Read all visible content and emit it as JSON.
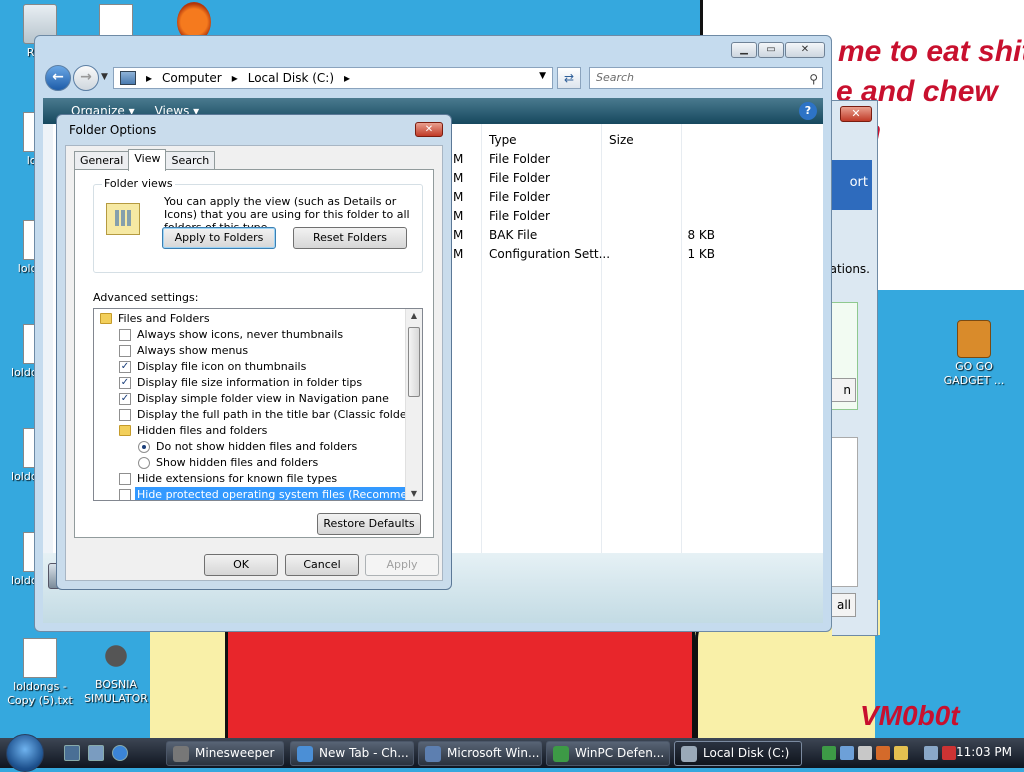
{
  "desktop": {
    "meme_lines": [
      "me to eat shit",
      "e and chew",
      "um"
    ],
    "watermark": "VM0b0t",
    "icons": [
      {
        "label": "Recy",
        "glyph": "recycle-bin"
      },
      {
        "label": "",
        "glyph": "document"
      },
      {
        "label": "",
        "glyph": "firefox"
      },
      {
        "label": "loldo",
        "glyph": "document"
      },
      {
        "label": "loldo Co",
        "glyph": "document"
      },
      {
        "label": "loldo Copy",
        "glyph": "document"
      },
      {
        "label": "loldo Copy",
        "glyph": "document"
      },
      {
        "label": "loldo Copy",
        "glyph": "document"
      },
      {
        "label": "loldongs - Copy (5).txt",
        "glyph": "document"
      },
      {
        "label": "BOSNIA SIMULATOR",
        "glyph": "minesweeper"
      },
      {
        "label": "GO GO GADGET ...",
        "glyph": "briefcase"
      }
    ]
  },
  "explorer": {
    "address_parts": [
      "Computer",
      "Local Disk (C:)"
    ],
    "search_placeholder": "Search",
    "cmd_organize": "Organize ▾",
    "cmd_views": "Views ▾",
    "columns": {
      "type": "Type",
      "size": "Size"
    },
    "rows": [
      {
        "mod": "M",
        "type": "File Folder",
        "size": ""
      },
      {
        "mod": "M",
        "type": "File Folder",
        "size": ""
      },
      {
        "mod": "M",
        "type": "File Folder",
        "size": ""
      },
      {
        "mod": "M",
        "type": "File Folder",
        "size": ""
      },
      {
        "mod": "M",
        "type": "BAK File",
        "size": "8 KB"
      },
      {
        "mod": "M",
        "type": "Configuration Sett...",
        "size": "1 KB"
      }
    ]
  },
  "background_window": {
    "panel_text": "ort",
    "text": "ations.",
    "button_text": "n",
    "button_all": "all"
  },
  "dialog": {
    "title": "Folder Options",
    "tabs": [
      "General",
      "View",
      "Search"
    ],
    "active_tab": "View",
    "folder_views_label": "Folder views",
    "folder_views_text": "You can apply the view (such as Details or Icons) that you are using for this folder to all folders of this type.",
    "apply_to_folders": "Apply to Folders",
    "reset_folders": "Reset Folders",
    "advanced_label": "Advanced settings:",
    "settings": [
      {
        "kind": "folder",
        "indent": 0,
        "label": "Files and Folders"
      },
      {
        "kind": "checkbox",
        "indent": 1,
        "checked": false,
        "label": "Always show icons, never thumbnails"
      },
      {
        "kind": "checkbox",
        "indent": 1,
        "checked": false,
        "label": "Always show menus"
      },
      {
        "kind": "checkbox",
        "indent": 1,
        "checked": true,
        "label": "Display file icon on thumbnails"
      },
      {
        "kind": "checkbox",
        "indent": 1,
        "checked": true,
        "label": "Display file size information in folder tips"
      },
      {
        "kind": "checkbox",
        "indent": 1,
        "checked": true,
        "label": "Display simple folder view in Navigation pane"
      },
      {
        "kind": "checkbox",
        "indent": 1,
        "checked": false,
        "label": "Display the full path in the title bar (Classic folders only)"
      },
      {
        "kind": "folder",
        "indent": 1,
        "label": "Hidden files and folders"
      },
      {
        "kind": "radio",
        "indent": 2,
        "checked": true,
        "label": "Do not show hidden files and folders"
      },
      {
        "kind": "radio",
        "indent": 2,
        "checked": false,
        "label": "Show hidden files and folders"
      },
      {
        "kind": "checkbox",
        "indent": 1,
        "checked": false,
        "label": "Hide extensions for known file types"
      },
      {
        "kind": "checkbox",
        "indent": 1,
        "checked": false,
        "selected": true,
        "label": "Hide protected operating system files (Recommended)"
      }
    ],
    "restore_defaults": "Restore Defaults",
    "ok": "OK",
    "cancel": "Cancel",
    "apply": "Apply"
  },
  "taskbar": {
    "tasks": [
      {
        "label": "Minesweeper",
        "icon": "minesweeper-icon",
        "active": false
      },
      {
        "label": "New Tab - Ch...",
        "icon": "chrome-icon",
        "active": false
      },
      {
        "label": "Microsoft Win...",
        "icon": "window-icon",
        "active": false
      },
      {
        "label": "WinPC Defen...",
        "icon": "shield-icon",
        "active": false
      },
      {
        "label": "Local Disk (C:)",
        "icon": "drive-icon",
        "active": true
      }
    ],
    "clock": "11:03 PM"
  }
}
